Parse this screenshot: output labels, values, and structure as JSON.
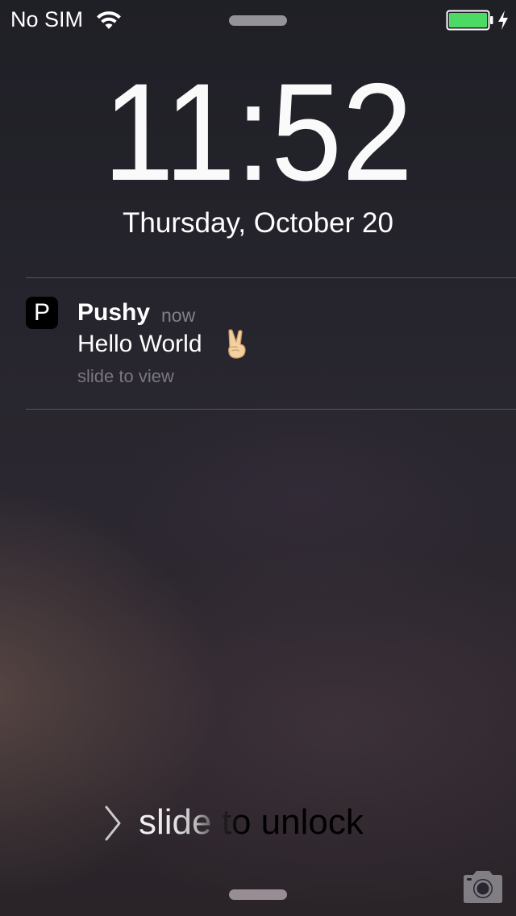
{
  "status_bar": {
    "carrier": "No SIM",
    "wifi_icon": "wifi-icon",
    "battery_icon": "battery-icon",
    "battery_level": 1.0,
    "charging_icon": "charging-bolt-icon",
    "battery_color": "#4cd964"
  },
  "lock_screen": {
    "time": "11:52",
    "date": "Thursday, October 20"
  },
  "notification": {
    "app_icon_letter": "P",
    "app_name": "Pushy",
    "time": "now",
    "message": "Hello World",
    "emoji_icon": "victory-hand-emoji-icon",
    "action": "slide to view"
  },
  "unlock": {
    "label": "slide to unlock",
    "chevron_icon": "chevron-right-icon",
    "camera_icon": "camera-icon"
  }
}
